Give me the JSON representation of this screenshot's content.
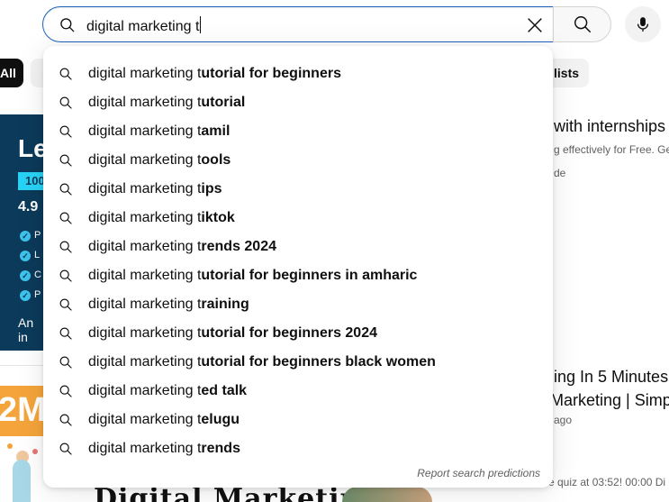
{
  "search": {
    "query": "digital marketing t",
    "clear_icon": "close-icon",
    "search_icon": "search-icon",
    "mic_icon": "microphone-icon"
  },
  "chips": {
    "all_label": "All",
    "playlists_label": "lists"
  },
  "suggestions": {
    "typed_prefix": "digital marketing t",
    "items": [
      {
        "typed": "digital marketing t",
        "completion": "utorial for beginners"
      },
      {
        "typed": "digital marketing t",
        "completion": "utorial"
      },
      {
        "typed": "digital marketing t",
        "completion": "amil"
      },
      {
        "typed": "digital marketing t",
        "completion": "ools"
      },
      {
        "typed": "digital marketing t",
        "completion": "ips"
      },
      {
        "typed": "digital marketing t",
        "completion": "iktok"
      },
      {
        "typed": "digital marketing t",
        "completion": "rends 2024"
      },
      {
        "typed": "digital marketing t",
        "completion": "utorial for beginners in amharic"
      },
      {
        "typed": "digital marketing t",
        "completion": "raining"
      },
      {
        "typed": "digital marketing t",
        "completion": "utorial for beginners 2024"
      },
      {
        "typed": "digital marketing t",
        "completion": "utorial for beginners black women"
      },
      {
        "typed": "digital marketing t",
        "completion": "ed talk"
      },
      {
        "typed": "digital marketing t",
        "completion": "elugu"
      },
      {
        "typed": "digital marketing t",
        "completion": "rends"
      }
    ],
    "report_label": "Report search predictions"
  },
  "background": {
    "video1": {
      "thumb_heading": "Le",
      "thumb_badge": "100",
      "thumb_rating": "4.9",
      "thumb_list_letters": [
        "P",
        "L",
        "C",
        "P"
      ],
      "thumb_footer": "An in",
      "title": "with internships",
      "description": "g effectively for Free. Ge",
      "meta": "de"
    },
    "video2": {
      "thumb_text": "2M",
      "title_line1": "ing In 5 Minutes",
      "title_line2": "Marketing | Simpl",
      "meta": "ago",
      "description": "e quiz at 03:52! 00:00 Di"
    },
    "video3": {
      "thumb_title": "Digital Marketing?"
    }
  },
  "colors": {
    "focus_border": "#1c62b9",
    "thumb_navy": "#0c3a5a",
    "thumb_cyan": "#27d3f5",
    "thumb_orange": "#f4a43a"
  }
}
